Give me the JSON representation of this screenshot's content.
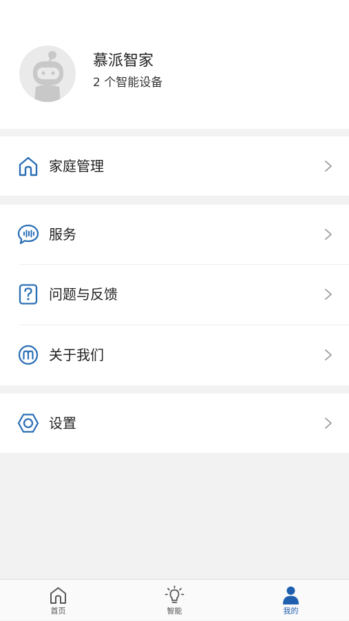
{
  "profile": {
    "name": "慕派智家",
    "device_count_text": "2 个智能设备"
  },
  "menu": {
    "home_management": "家庭管理",
    "service": "服务",
    "feedback": "问题与反馈",
    "about_us": "关于我们",
    "settings": "设置"
  },
  "tabbar": {
    "home": "首页",
    "smart": "智能",
    "mine": "我的",
    "active_tab": "我的"
  },
  "colors": {
    "accent": "#1f5fae",
    "icon_blue": "#2a6eb5",
    "background": "#f2f2f2"
  }
}
